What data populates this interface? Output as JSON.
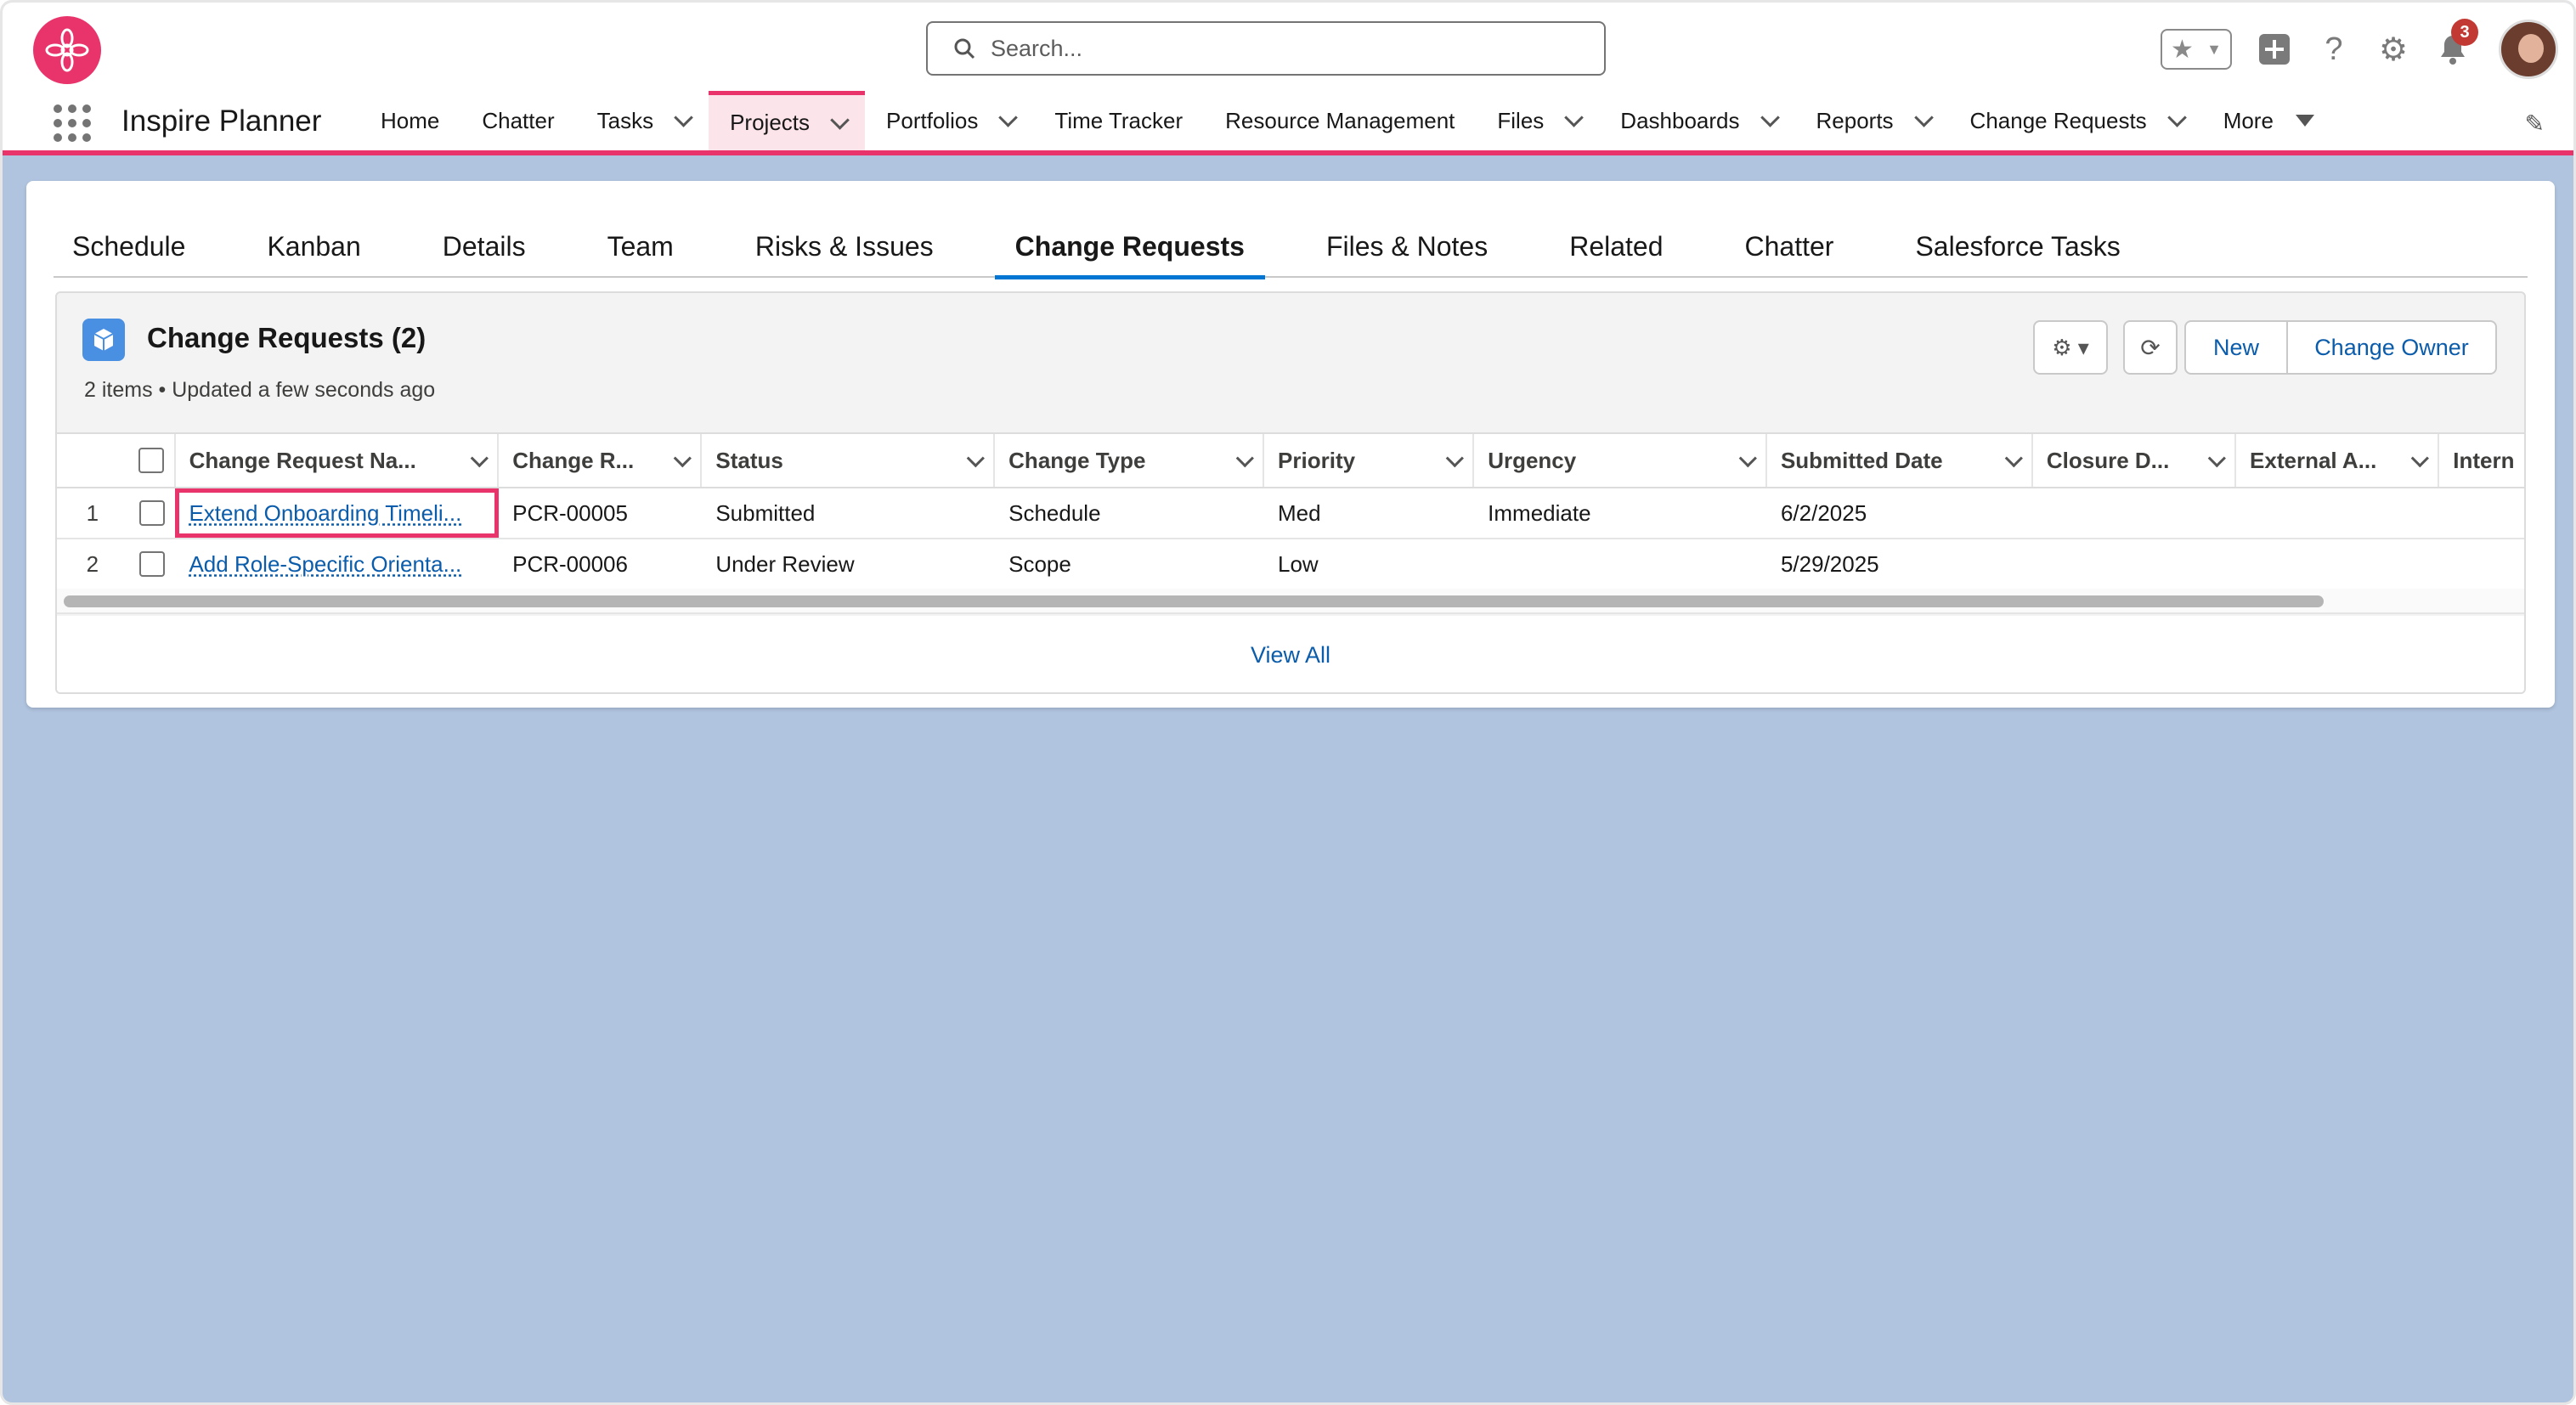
{
  "header": {
    "search_placeholder": "Search...",
    "notification_count": "3",
    "icons": [
      "favorites-star-icon",
      "add-icon",
      "help-icon",
      "setup-gear-icon",
      "notifications-bell-icon",
      "avatar"
    ]
  },
  "nav": {
    "app_name": "Inspire Planner",
    "items": [
      {
        "label": "Home",
        "dropdown": false
      },
      {
        "label": "Chatter",
        "dropdown": false
      },
      {
        "label": "Tasks",
        "dropdown": true
      },
      {
        "label": "Projects",
        "dropdown": true,
        "active": true
      },
      {
        "label": "Portfolios",
        "dropdown": true
      },
      {
        "label": "Time Tracker",
        "dropdown": false
      },
      {
        "label": "Resource Management",
        "dropdown": false
      },
      {
        "label": "Files",
        "dropdown": true
      },
      {
        "label": "Dashboards",
        "dropdown": true
      },
      {
        "label": "Reports",
        "dropdown": true
      },
      {
        "label": "Change Requests",
        "dropdown": true
      },
      {
        "label": "More",
        "dropdown": true
      }
    ]
  },
  "tabs": [
    "Schedule",
    "Kanban",
    "Details",
    "Team",
    "Risks & Issues",
    "Change Requests",
    "Files & Notes",
    "Related",
    "Chatter",
    "Salesforce Tasks"
  ],
  "active_tab": "Change Requests",
  "related_list": {
    "title": "Change Requests (2)",
    "subtitle": "2 items • Updated a few seconds ago",
    "buttons": {
      "new": "New",
      "change_owner": "Change Owner"
    },
    "columns": [
      "Change Request Na...",
      "Change R...",
      "Status",
      "Change Type",
      "Priority",
      "Urgency",
      "Submitted Date",
      "Closure D...",
      "External A...",
      "Intern"
    ],
    "rows": [
      {
        "num": "1",
        "name": "Extend Onboarding Timeli...",
        "number": "PCR-00005",
        "status": "Submitted",
        "type": "Schedule",
        "priority": "Med",
        "urgency": "Immediate",
        "submitted": "6/2/2025",
        "closure": "",
        "external": "",
        "internal": ""
      },
      {
        "num": "2",
        "name": "Add Role-Specific Orienta...",
        "number": "PCR-00006",
        "status": "Under Review",
        "type": "Scope",
        "priority": "Low",
        "urgency": "",
        "submitted": "5/29/2025",
        "closure": "",
        "external": "",
        "internal": ""
      }
    ],
    "view_all": "View All"
  },
  "colors": {
    "brand": "#e8336b",
    "link": "#0b5cab",
    "background": "#b0c4df",
    "active_tab": "#0176d3"
  }
}
